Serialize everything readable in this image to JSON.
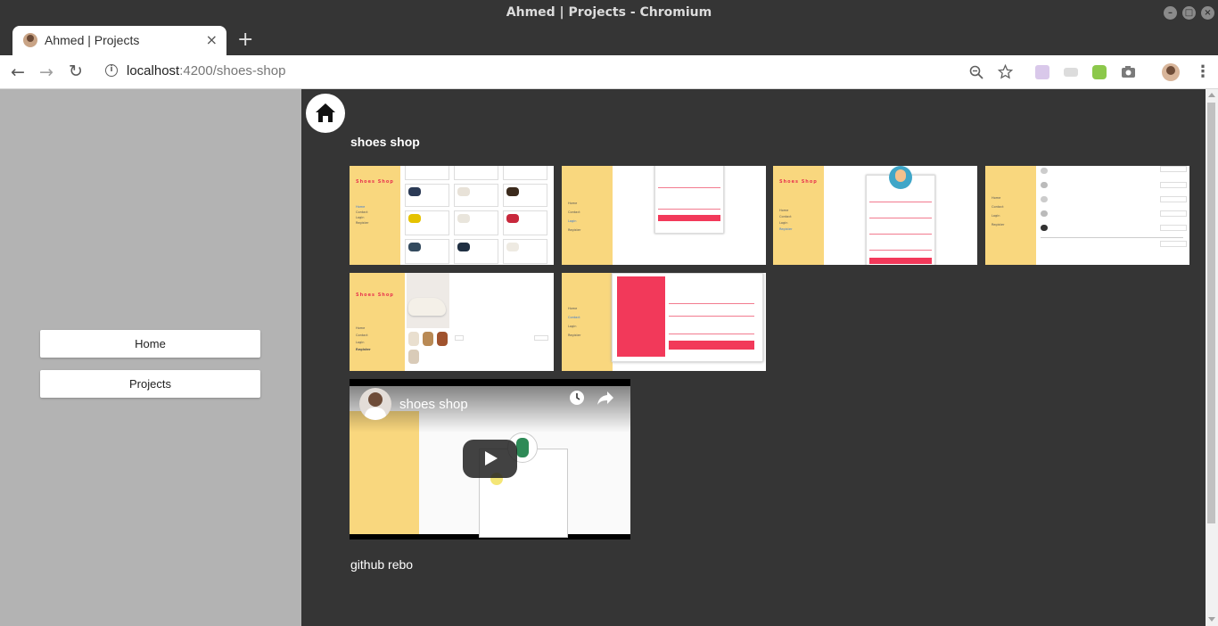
{
  "window": {
    "title": "Ahmed | Projects - Chromium"
  },
  "tab": {
    "label": "Ahmed | Projects",
    "close": "×",
    "new_tab": "+"
  },
  "toolbar": {
    "back": "←",
    "forward": "→",
    "reload": "↻",
    "url_host": "localhost",
    "url_rest": ":4200/shoes-shop",
    "zoom_icon": "magnifier-icon",
    "star_icon": "star-icon"
  },
  "sidebar": {
    "items": [
      {
        "label": "Home"
      },
      {
        "label": "Projects"
      }
    ]
  },
  "main": {
    "title": "shoes shop",
    "video": {
      "title": "shoes shop"
    },
    "link": "github rebo"
  },
  "thumbs": {
    "logo": "Shoes Shop",
    "nav": [
      "Home",
      "Contact",
      "Login",
      "Register"
    ]
  },
  "colors": {
    "accent_yellow": "#f9d77e",
    "accent_pink": "#f2395a",
    "background": "#353535",
    "sidebar": "#b3b3b3"
  }
}
